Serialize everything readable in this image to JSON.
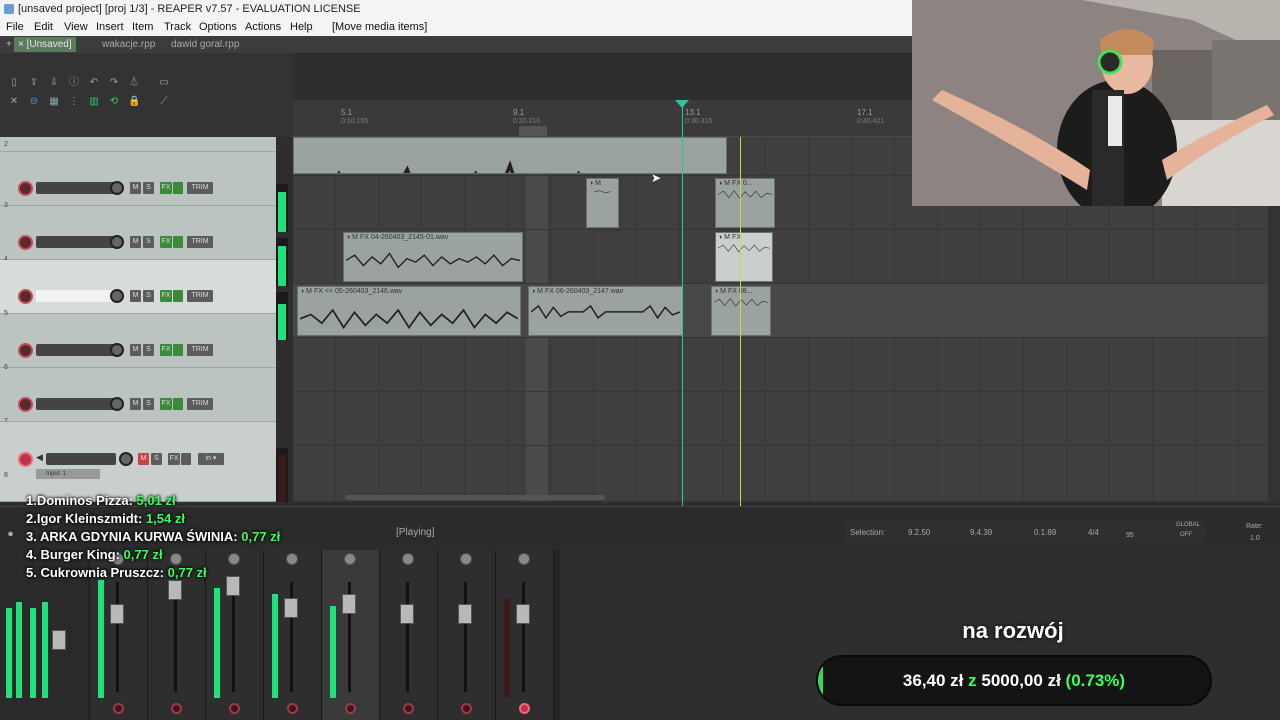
{
  "window": {
    "title": "[unsaved project] [proj 1/3] - REAPER v7.57 - EVALUATION LICENSE"
  },
  "menu": {
    "items": [
      "File",
      "Edit",
      "View",
      "Insert",
      "Item",
      "Track",
      "Options",
      "Actions",
      "Help",
      "[Move media items]"
    ]
  },
  "tabs": [
    {
      "label": "[Unsaved]",
      "active": true
    },
    {
      "label": "wakacje.rpp",
      "active": false
    },
    {
      "label": "dawid goral.rpp",
      "active": false
    }
  ],
  "ruler": {
    "marks": [
      {
        "label": "5.1",
        "time": "0:10.105"
      },
      {
        "label": "9.1",
        "time": "0:20.210"
      },
      {
        "label": "13.1",
        "time": "0:30.315"
      },
      {
        "label": "17.1",
        "time": "0:40.421"
      }
    ]
  },
  "tracks": {
    "numbers": [
      "2",
      "3",
      "4",
      "5",
      "6",
      "7",
      "8"
    ],
    "button_labels": {
      "mute": "M",
      "solo": "S",
      "fx": "FX",
      "trim": "TRIM"
    },
    "input_label": "Input: 1"
  },
  "items": {
    "track4_item1": "04-260403_2145-01.wav",
    "track5_item1": "<< 05-260403_2146.wav",
    "track5_item2": "06-260403_2147.wav",
    "track5_item3": "08...",
    "track3_item2": "0..."
  },
  "transport": {
    "status": "[Playing]",
    "selection_label": "Selection:",
    "selection_start": "9.2.50",
    "selection_end": "9.4.39",
    "selection_length": "0.1.89",
    "time_signature": "4/4",
    "bpm": "95",
    "rate_label": "Rate:",
    "rate_value": "1.0",
    "global_label": "GLOBAL",
    "global_value": "OFF"
  },
  "leaderboard": [
    {
      "rank": "1.",
      "name": "Dominos Pizza:",
      "amount": "5,01 zł"
    },
    {
      "rank": "2.",
      "name": "Igor Kleinszmidt:",
      "amount": "1,54 zł"
    },
    {
      "rank": "3.",
      "name": "ARKA GDYNIA KURWA ŚWINIA:",
      "amount": "0,77 zł"
    },
    {
      "rank": "4.",
      "name": "Burger King:",
      "amount": "0,77 zł"
    },
    {
      "rank": "5.",
      "name": "Cukrownia Pruszcz:",
      "amount": "0,77 zł"
    }
  ],
  "goal": {
    "label": "na rozwój",
    "current": "36,40 zł",
    "separator": "z",
    "target": "5000,00 zł",
    "percent_text": "(0.73%)",
    "progress_fraction": 0.0073
  },
  "colors": {
    "accent_green": "#3cff5a",
    "reaper_bg": "#3f3f3f",
    "meter_green": "#1ee37a",
    "playhead": "#2ec4a0",
    "edit_cursor": "#d9d23a"
  }
}
